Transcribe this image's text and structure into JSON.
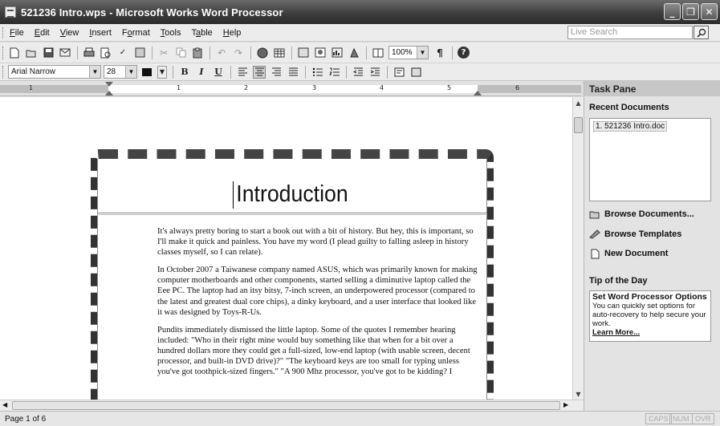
{
  "window": {
    "title": "521236 Intro.wps - Microsoft Works Word Processor",
    "min_icon": "_",
    "max_icon": "❐",
    "close_icon": "✕"
  },
  "menu": {
    "items": [
      {
        "key": "F",
        "rest": "ile"
      },
      {
        "key": "E",
        "rest": "dit"
      },
      {
        "key": "V",
        "rest": "iew"
      },
      {
        "key": "I",
        "rest": "nsert"
      },
      {
        "key": "",
        "pre": "F",
        "u": "o",
        "rest": "rmat"
      },
      {
        "key": "T",
        "rest": "ools"
      },
      {
        "key": "",
        "pre": "T",
        "u": "a",
        "rest": "ble"
      },
      {
        "key": "H",
        "rest": "elp"
      }
    ],
    "search_placeholder": "Live Search"
  },
  "toolbar": {
    "zoom": "100%",
    "pilcrow": "¶",
    "help": "?"
  },
  "format": {
    "font": "Arial Narrow",
    "size": "28",
    "bold": "B",
    "italic": "I",
    "underline": "U"
  },
  "ruler": {
    "numbers": [
      "1",
      "1",
      "2",
      "3",
      "4",
      "5",
      "6"
    ]
  },
  "document": {
    "heading": "Introduction",
    "paragraphs": [
      "It's always pretty boring to start a book out with a bit of history. But hey, this is important, so I'll make it quick and painless. You have my word (I plead guilty to falling asleep in history classes myself, so I can relate).",
      "In October 2007 a Taiwanese company named ASUS, which was primarily known for making computer motherboards and other components, started selling a diminutive laptop called the Eee PC. The laptop had an itsy bitsy, 7-inch screen, an underpowered processor (compared to the latest and greatest dual core chips), a dinky keyboard, and a user interface that looked like it was designed by Toys-R-Us.",
      "Pundits immediately dismissed the little laptop. Some of the quotes I remember hearing included: \"Who in their right mine would buy something like that when for a bit over a hundred dollars more they could get a full-sized, low-end laptop (with usable screen, decent processor, and built-in DVD drive)?\" \"The keyboard keys are too small for typing unless you've got toothpick-sized fingers.\" \"A 900 Mhz processor, you've got to be kidding? I"
    ]
  },
  "taskpane": {
    "title": "Task Pane",
    "recent_heading": "Recent Documents",
    "recent_items": [
      "1. 521236 Intro.doc"
    ],
    "browse_documents": "Browse Documents...",
    "browse_templates": "Browse Templates",
    "new_document": "New Document",
    "tip_heading": "Tip of the Day",
    "tip_title": "Set Word Processor Options",
    "tip_text": "You can quickly set options for auto-recovery to help secure your work.",
    "learn_more": "Learn More..."
  },
  "status": {
    "page": "Page 1 of 6",
    "caps": "CAPS",
    "num": "NUM",
    "ovr": "OVR"
  }
}
